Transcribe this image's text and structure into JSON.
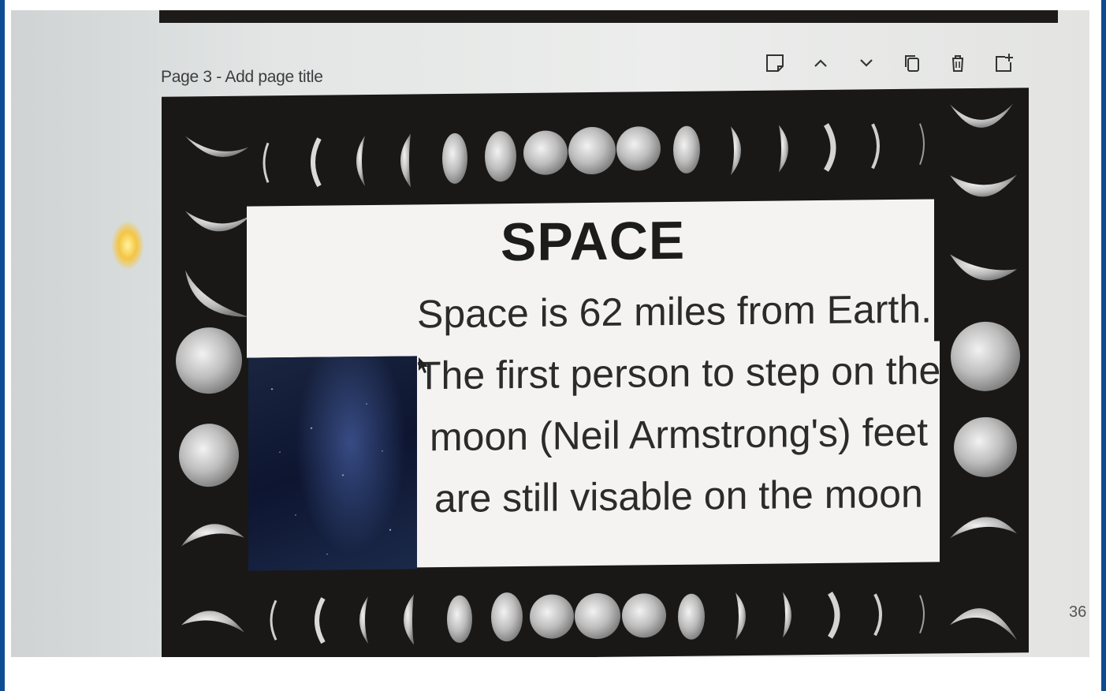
{
  "page": {
    "label": "Page 3 - Add page title",
    "number_partial": "36"
  },
  "toolbar": {
    "icons": [
      "add-note-icon",
      "chevron-up-icon",
      "chevron-down-icon",
      "duplicate-icon",
      "trash-icon",
      "add-page-icon"
    ]
  },
  "slide": {
    "title": "SPACE",
    "body_lines": [
      "Space is 62 miles from Earth.",
      "The first person to step on the",
      "moon (Neil Armstrong's) feet",
      "are still visable on the moon"
    ]
  },
  "colors": {
    "frame_bar": "#0d4c93",
    "slide_background": "#1a1817",
    "panel": "#f4f3f1",
    "text": "#2b2b2b"
  }
}
